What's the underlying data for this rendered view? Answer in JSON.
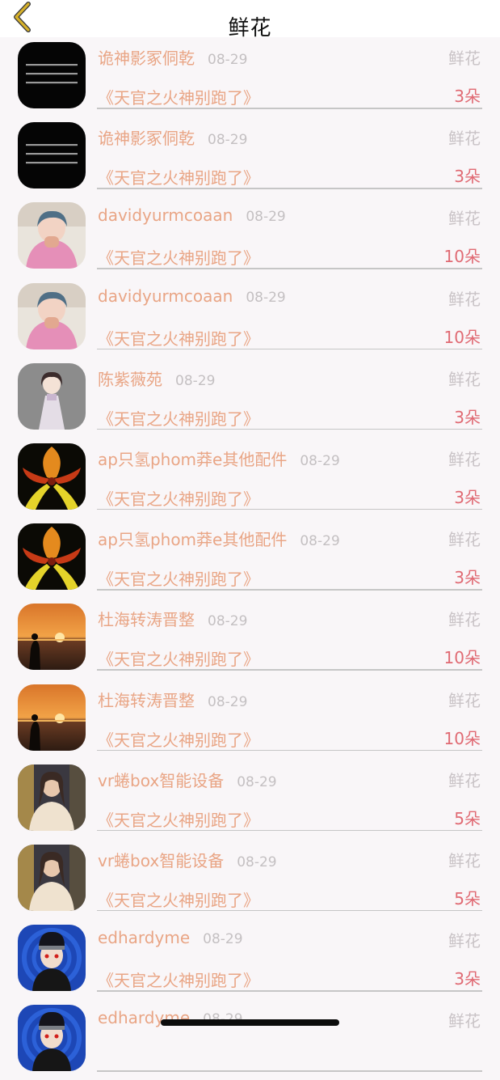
{
  "nav": {
    "title": "鲜花",
    "back_icon": "chevron-left-icon"
  },
  "colors": {
    "accent_gold": "#c9a21a",
    "name_orange": "#e9a585",
    "count_red": "#e06a73",
    "gray_text": "#c4c0c2"
  },
  "rows": [
    {
      "name": "诡神影冢侗乾",
      "date": "08-29",
      "type": "鲜花",
      "book": "《天官之火神别跑了》",
      "count": "3朵",
      "avatar": "text-card-avatar"
    },
    {
      "name": "诡神影冢侗乾",
      "date": "08-29",
      "type": "鲜花",
      "book": "《天官之火神别跑了》",
      "count": "3朵",
      "avatar": "text-card-avatar"
    },
    {
      "name": "davidyurmcoaan",
      "date": "08-29",
      "type": "鲜花",
      "book": "《天官之火神别跑了》",
      "count": "10朵",
      "avatar": "girl-pink-sweater-avatar"
    },
    {
      "name": "davidyurmcoaan",
      "date": "08-29",
      "type": "鲜花",
      "book": "《天官之火神别跑了》",
      "count": "10朵",
      "avatar": "girl-pink-sweater-avatar"
    },
    {
      "name": "陈紫薇苑",
      "date": "08-29",
      "type": "鲜花",
      "book": "《天官之火神别跑了》",
      "count": "3朵",
      "avatar": "cartoon-girl-avatar"
    },
    {
      "name": "ap只氢phom莽e其他配件",
      "date": "08-29",
      "type": "鲜花",
      "book": "《天官之火神别跑了》",
      "count": "3朵",
      "avatar": "orchid-flower-avatar"
    },
    {
      "name": "ap只氢phom莽e其他配件",
      "date": "08-29",
      "type": "鲜花",
      "book": "《天官之火神别跑了》",
      "count": "3朵",
      "avatar": "orchid-flower-avatar"
    },
    {
      "name": "杜海转涛晋整",
      "date": "08-29",
      "type": "鲜花",
      "book": "《天官之火神别跑了》",
      "count": "10朵",
      "avatar": "sunset-silhouette-avatar"
    },
    {
      "name": "杜海转涛晋整",
      "date": "08-29",
      "type": "鲜花",
      "book": "《天官之火神别跑了》",
      "count": "10朵",
      "avatar": "sunset-silhouette-avatar"
    },
    {
      "name": "vr蜷box智能设备",
      "date": "08-29",
      "type": "鲜花",
      "book": "《天官之火神别跑了》",
      "count": "5朵",
      "avatar": "woman-portrait-avatar"
    },
    {
      "name": "vr蜷box智能设备",
      "date": "08-29",
      "type": "鲜花",
      "book": "《天官之火神别跑了》",
      "count": "5朵",
      "avatar": "woman-portrait-avatar"
    },
    {
      "name": "edhardyme",
      "date": "08-29",
      "type": "鲜花",
      "book": "《天官之火神别跑了》",
      "count": "3朵",
      "avatar": "anime-ninja-avatar"
    },
    {
      "name": "edhardyme",
      "date": "08-29",
      "type": "鲜花",
      "book": "",
      "count": "",
      "avatar": "anime-ninja-avatar"
    }
  ]
}
